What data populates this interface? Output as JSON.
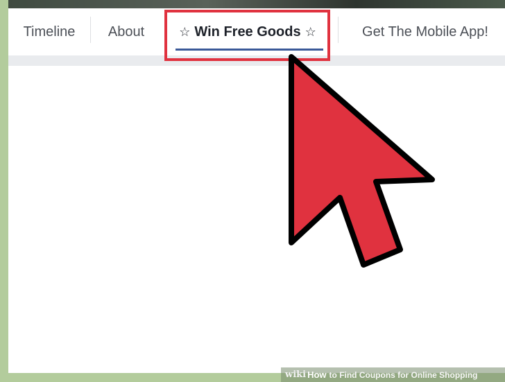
{
  "nav": {
    "tabs": [
      {
        "label": "Timeline"
      },
      {
        "label": "About"
      },
      {
        "label": "Win Free Goods",
        "star": "☆",
        "active": true
      },
      {
        "label": "Get The Mobile App!"
      }
    ]
  },
  "annotation": {
    "box_color": "#e0323f",
    "cursor_color": "#e0323f",
    "cursor_icon": "mouse-pointer-arrow"
  },
  "caption": {
    "brand": "wiki",
    "how": "How",
    "title": "to Find Coupons for Online Shopping"
  },
  "colors": {
    "accent": "#3b5998",
    "background": "#b3cc9c"
  }
}
